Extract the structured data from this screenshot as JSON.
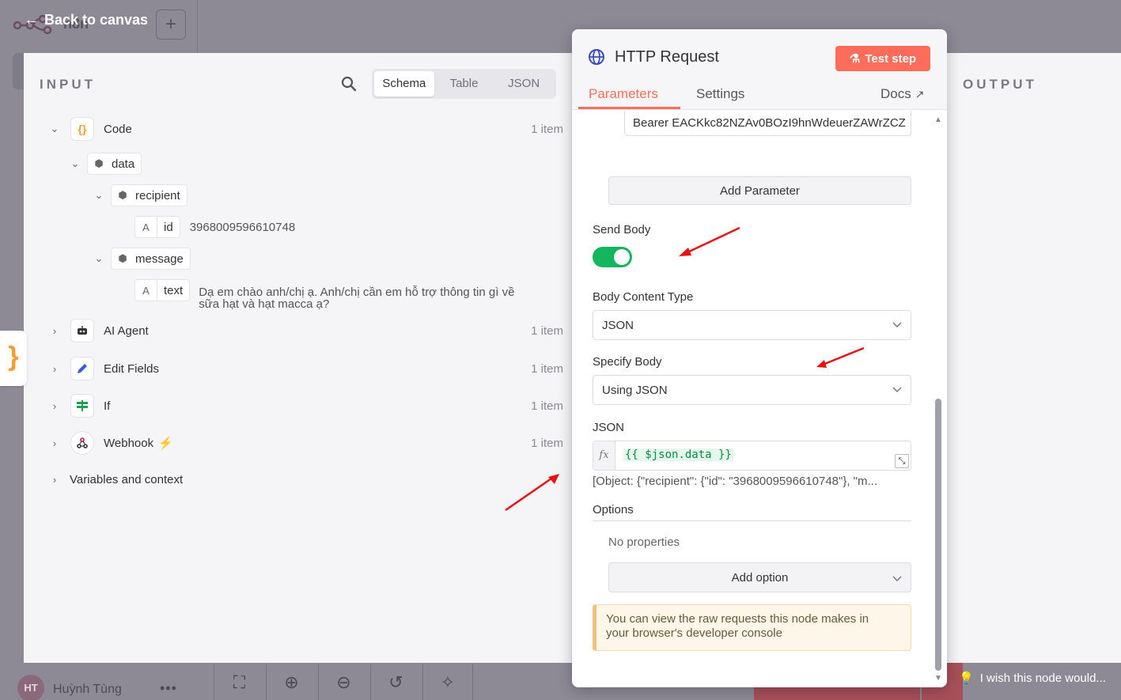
{
  "background": {
    "workflow_name": "n8n",
    "back_label": "Back to canvas",
    "user_initials": "HT",
    "user_name": "Huỳnh Tùng",
    "more_label": "•••",
    "wish_label": "I wish this node would..."
  },
  "input_panel": {
    "title": "INPUT",
    "view_options": [
      "Schema",
      "Table",
      "JSON"
    ],
    "active_view": "Schema",
    "tree": {
      "code": {
        "label": "Code",
        "count": "1 item"
      },
      "data": {
        "label": "data"
      },
      "recipient": {
        "label": "recipient"
      },
      "id": {
        "label": "id",
        "value": "3968009596610748"
      },
      "message": {
        "label": "message"
      },
      "text": {
        "label": "text",
        "value_line1": "Dạ em chào anh/chị ạ. Anh/chị cần em hỗ trợ thông tin gì về",
        "value_line2": "sữa hạt và hạt macca ạ?"
      }
    },
    "nodes": [
      {
        "label": "AI Agent",
        "count": "1 item"
      },
      {
        "label": "Edit Fields",
        "count": "1 item"
      },
      {
        "label": "If",
        "count": "1 item"
      },
      {
        "label": "Webhook",
        "count": "1 item"
      }
    ],
    "variables_label": "Variables and context"
  },
  "output_panel": {
    "title": "OUTPUT"
  },
  "modal": {
    "title": "HTTP Request",
    "test_button": "Test step",
    "tabs": {
      "parameters": "Parameters",
      "settings": "Settings",
      "docs": "Docs"
    },
    "header_value": "Bearer EACKkc82NZAv0BOzI9hnWdeuerZAWrZCZ",
    "add_parameter": "Add Parameter",
    "send_body_label": "Send Body",
    "send_body_on": true,
    "body_content_type_label": "Body Content Type",
    "body_content_type_value": "JSON",
    "specify_body_label": "Specify Body",
    "specify_body_value": "Using JSON",
    "json_label": "JSON",
    "fx_label": "fx",
    "json_expression": "{{ $json.data }}",
    "json_preview": "[Object: {\"recipient\": {\"id\": \"3968009596610748\"}, \"m...",
    "options_label": "Options",
    "no_properties": "No properties",
    "add_option": "Add option",
    "notice_line1": "You can view the raw requests this node makes in",
    "notice_line2": "your browser's developer console"
  },
  "colors": {
    "accent": "#ff6d5a",
    "toggle_on": "#13b55f",
    "expression_green": "#0d8a4a",
    "annotation_arrow": "#e81010"
  }
}
